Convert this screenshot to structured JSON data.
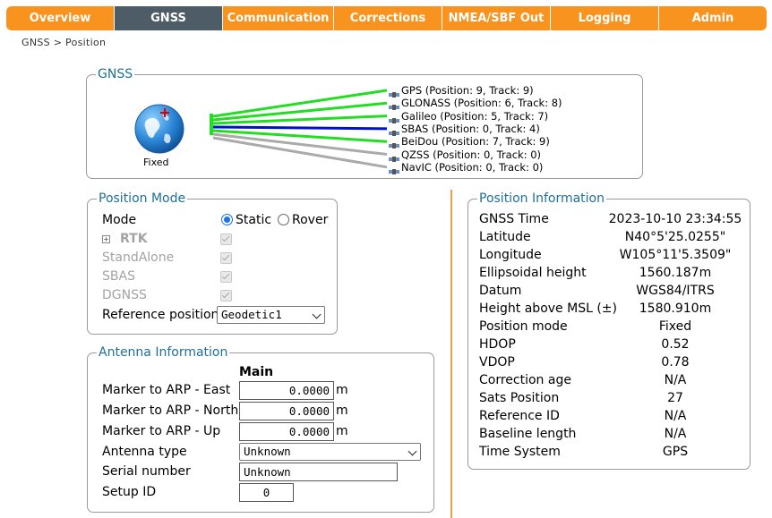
{
  "nav": {
    "tabs": [
      {
        "label": "Overview",
        "active": false
      },
      {
        "label": "GNSS",
        "active": true
      },
      {
        "label": "Communication",
        "active": false
      },
      {
        "label": "Corrections",
        "active": false
      },
      {
        "label": "NMEA/SBF Out",
        "active": false
      },
      {
        "label": "Logging",
        "active": false
      },
      {
        "label": "Admin",
        "active": false
      }
    ]
  },
  "breadcrumb": "GNSS > Position",
  "gnss_panel": {
    "legend": "GNSS",
    "globe_label": "Fixed",
    "constellations": [
      {
        "label": "GPS (Position: 9, Track: 9)",
        "color": "#22dd22"
      },
      {
        "label": "GLONASS (Position: 6, Track: 8)",
        "color": "#22dd22"
      },
      {
        "label": "Galileo (Position: 5, Track: 7)",
        "color": "#22dd22"
      },
      {
        "label": "SBAS (Position: 0, Track: 4)",
        "color": "#0011cc"
      },
      {
        "label": "BeiDou (Position: 7, Track: 9)",
        "color": "#22dd22"
      },
      {
        "label": "QZSS (Position: 0, Track: 0)",
        "color": "#aaaaaa"
      },
      {
        "label": "NavIC (Position: 0, Track: 0)",
        "color": "#aaaaaa"
      }
    ]
  },
  "position_mode": {
    "legend": "Position Mode",
    "mode_label": "Mode",
    "static_label": "Static",
    "rover_label": "Rover",
    "selected_mode": "Static",
    "rtk_label": "RTK",
    "standalone_label": "StandAlone",
    "sbas_label": "SBAS",
    "dgnss_label": "DGNSS",
    "reference_label": "Reference position",
    "reference_value": "Geodetic1"
  },
  "antenna": {
    "legend": "Antenna Information",
    "column_header": "Main",
    "east_label": "Marker to ARP - East",
    "east_value": "0.0000",
    "north_label": "Marker to ARP - North",
    "north_value": "0.0000",
    "up_label": "Marker to ARP - Up",
    "up_value": "0.0000",
    "unit": "m",
    "type_label": "Antenna type",
    "type_value": "Unknown",
    "serial_label": "Serial number",
    "serial_value": "Unknown",
    "setup_label": "Setup ID",
    "setup_value": "0"
  },
  "position_info": {
    "legend": "Position Information",
    "rows": [
      {
        "label": "GNSS Time",
        "value": "2023-10-10 23:34:55"
      },
      {
        "label": "Latitude",
        "value": "N40°5'25.0255\""
      },
      {
        "label": "Longitude",
        "value": "W105°11'5.3509\""
      },
      {
        "label": "Ellipsoidal height",
        "value": "1560.187m"
      },
      {
        "label": "Datum",
        "value": "WGS84/ITRS"
      },
      {
        "label": "Height above MSL (±)",
        "value": "1580.910m"
      },
      {
        "label": "Position mode",
        "value": "Fixed"
      },
      {
        "label": "HDOP",
        "value": "0.52"
      },
      {
        "label": "VDOP",
        "value": "0.78"
      },
      {
        "label": "Correction age",
        "value": "N/A"
      },
      {
        "label": "Sats Position",
        "value": "27"
      },
      {
        "label": "Reference ID",
        "value": "N/A"
      },
      {
        "label": "Baseline length",
        "value": "N/A"
      },
      {
        "label": "Time System",
        "value": "GPS"
      }
    ]
  },
  "colors": {
    "accent": "#f7931e",
    "active_tab": "#4e5c67",
    "legend": "#1f6f96",
    "divider": "#f0a040"
  }
}
